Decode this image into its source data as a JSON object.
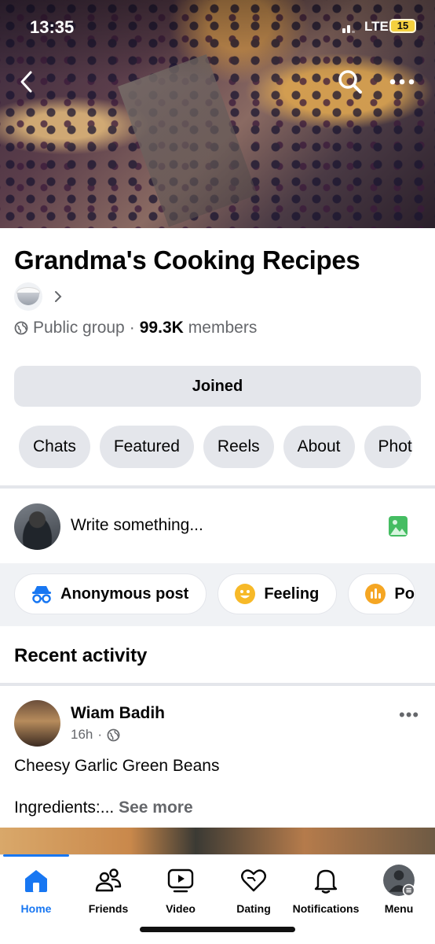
{
  "status_bar": {
    "time": "13:35",
    "network": "LTE",
    "battery": "15"
  },
  "group": {
    "name": "Grandma's Cooking Recipes",
    "privacy": "Public group",
    "separator": "·",
    "members_count": "99.3K",
    "members_label": "members",
    "joined_label": "Joined"
  },
  "tabs": [
    "Chats",
    "Featured",
    "Reels",
    "About",
    "Phot"
  ],
  "composer": {
    "placeholder": "Write something..."
  },
  "post_actions": [
    "Anonymous post",
    "Feeling",
    "Po"
  ],
  "recent_activity": {
    "title": "Recent activity"
  },
  "post": {
    "author": "Wiam Badih",
    "time": "16h",
    "separator": "·",
    "text": "Cheesy Garlic Green Beans",
    "text_line2": "Ingredients:...",
    "see_more": "See more",
    "more": "•••"
  },
  "bottom_nav": {
    "items": [
      "Home",
      "Friends",
      "Video",
      "Dating",
      "Notifications",
      "Menu"
    ],
    "active": "Home"
  },
  "colors": {
    "accent": "#1877f2",
    "chip_bg": "#e4e6eb",
    "muted_text": "#65676b"
  }
}
